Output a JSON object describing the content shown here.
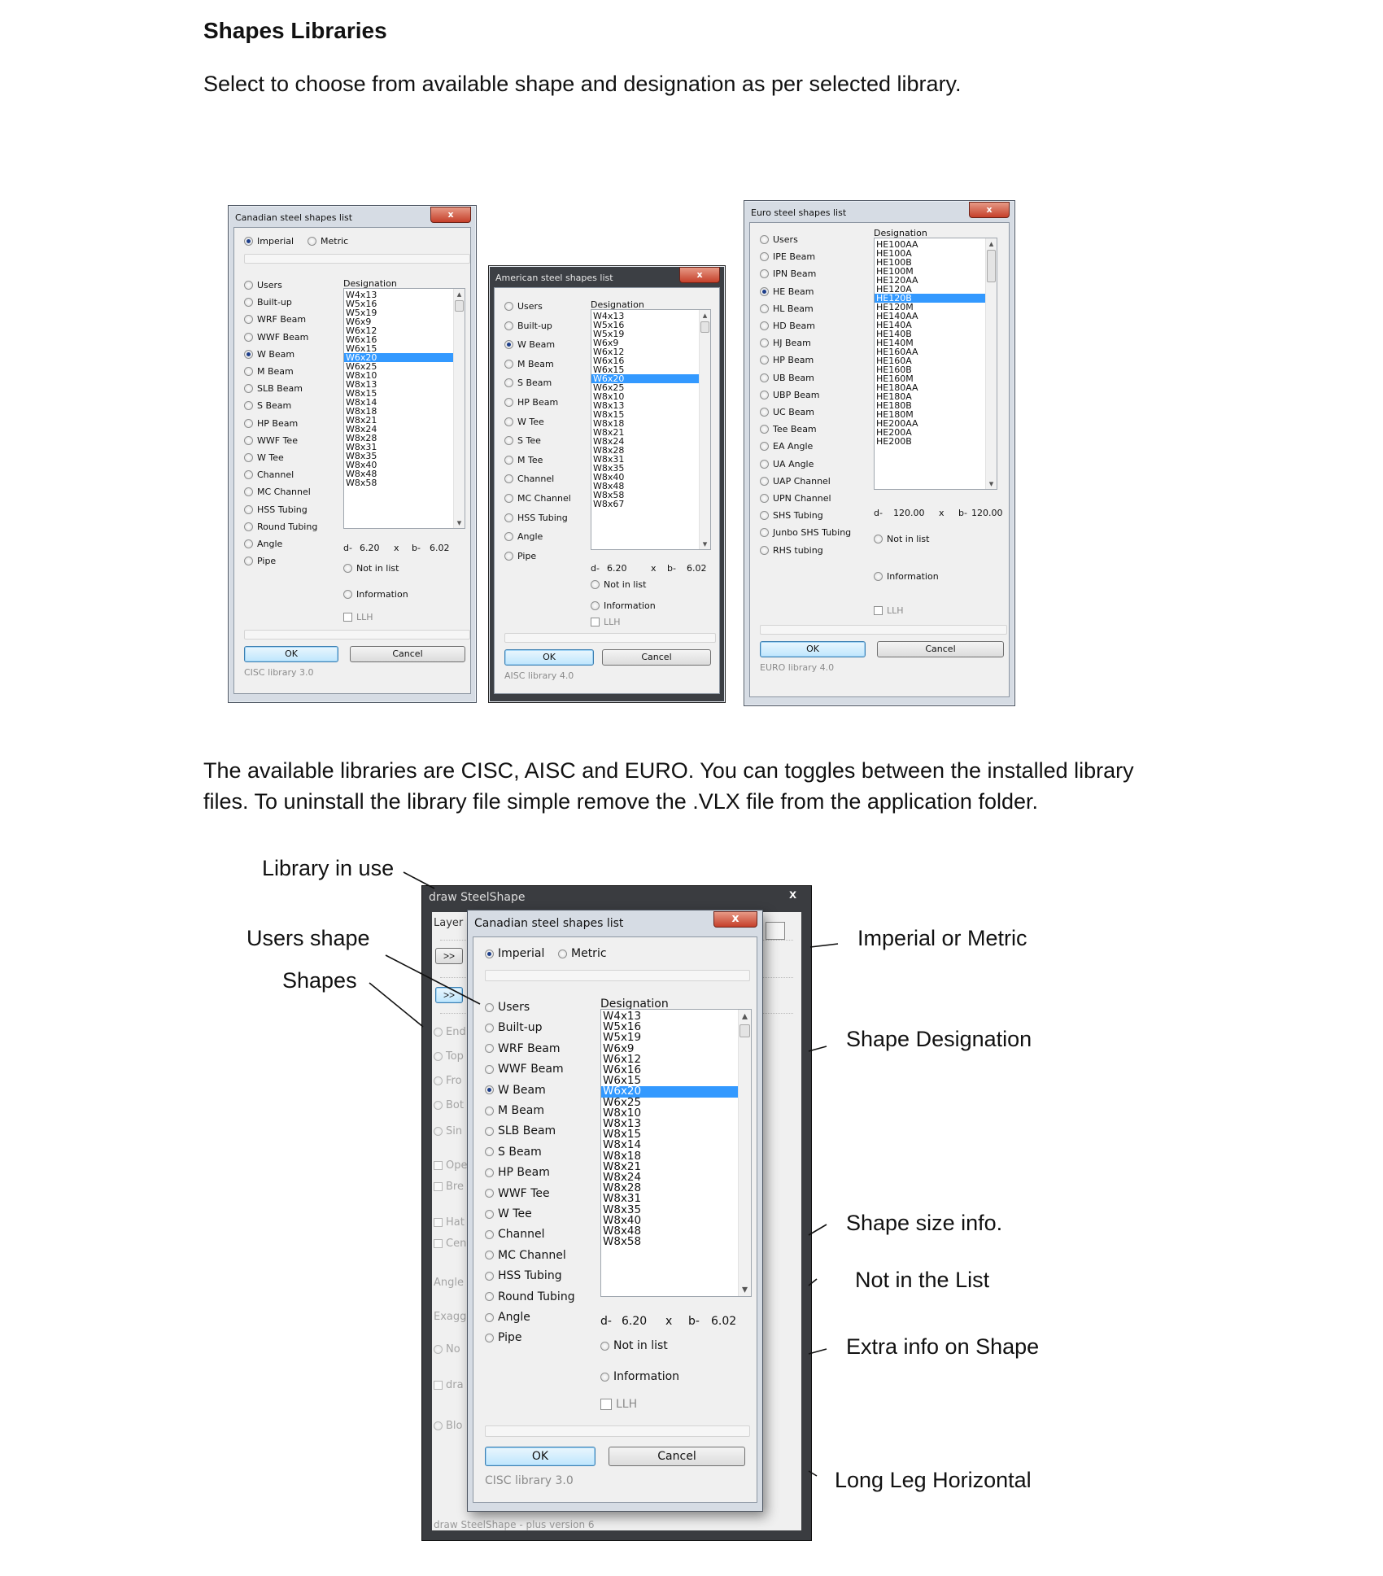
{
  "page": {
    "title": "Shapes Libraries",
    "intro": "Select to choose from available shape and designation as per selected library.",
    "para2_line1": "The available libraries are CISC, AISC and EURO.  You can toggles between the installed library",
    "para2_line2": "files.  To uninstall the library file simple remove the .VLX file from the application folder."
  },
  "canadian": {
    "title": "Canadian steel shapes list",
    "unit_options": [
      "Imperial",
      "Metric"
    ],
    "shapes": [
      "Users",
      "Built-up",
      "WRF Beam",
      "WWF Beam",
      "W Beam",
      "M Beam",
      "SLB Beam",
      "S Beam",
      "HP Beam",
      "WWF Tee",
      "W Tee",
      "Channel",
      "MC Channel",
      "HSS Tubing",
      "Round Tubing",
      "Angle",
      "Pipe"
    ],
    "selected_shape": "W Beam",
    "designation_header": "Designation",
    "designations": [
      "W4x13",
      "W5x16",
      "W5x19",
      "W6x9",
      "W6x12",
      "W6x16",
      "W6x15",
      "W6x20",
      "W6x25",
      "W8x10",
      "W8x13",
      "W8x15",
      "W8x14",
      "W8x18",
      "W8x21",
      "W8x24",
      "W8x28",
      "W8x31",
      "W8x35",
      "W8x40",
      "W8x48",
      "W8x58"
    ],
    "selected_designation": "W6x20",
    "d_label": "d-",
    "d_value": "6.20",
    "x_label": "x",
    "b_label": "b-",
    "b_value": "6.02",
    "not_in_list": "Not in list",
    "information": "Information",
    "llh": "LLH",
    "ok": "OK",
    "cancel": "Cancel",
    "library": "CISC library 3.0",
    "close": "x"
  },
  "american": {
    "title": "American steel shapes list",
    "shapes": [
      "Users",
      "Built-up",
      "W Beam",
      "M Beam",
      "S Beam",
      "HP Beam",
      "W Tee",
      "S Tee",
      "M Tee",
      "Channel",
      "MC Channel",
      "HSS Tubing",
      "Angle",
      "Pipe"
    ],
    "selected_shape": "W Beam",
    "designation_header": "Designation",
    "designations": [
      "W4x13",
      "W5x16",
      "W5x19",
      "W6x9",
      "W6x12",
      "W6x16",
      "W6x15",
      "W6x20",
      "W6x25",
      "W8x10",
      "W8x13",
      "W8x15",
      "W8x18",
      "W8x21",
      "W8x24",
      "W8x28",
      "W8x31",
      "W8x35",
      "W8x40",
      "W8x48",
      "W8x58",
      "W8x67"
    ],
    "selected_designation": "W6x20",
    "d_label": "d-",
    "d_value": "6.20",
    "x_label": "x",
    "b_label": "b-",
    "b_value": "6.02",
    "not_in_list": "Not in list",
    "information": "Information",
    "llh": "LLH",
    "ok": "OK",
    "cancel": "Cancel",
    "library": "AISC library 4.0",
    "close": "x"
  },
  "euro": {
    "title": "Euro steel shapes list",
    "shapes": [
      "Users",
      "IPE Beam",
      "IPN Beam",
      "HE Beam",
      "HL Beam",
      "HD Beam",
      "HJ Beam",
      "HP Beam",
      "UB Beam",
      "UBP Beam",
      "UC Beam",
      "Tee Beam",
      "EA Angle",
      "UA Angle",
      "UAP Channel",
      "UPN Channel",
      "SHS Tubing",
      "Junbo SHS Tubing",
      "RHS tubing"
    ],
    "selected_shape": "HE Beam",
    "designation_header": "Designation",
    "designations": [
      "HE100AA",
      "HE100A",
      "HE100B",
      "HE100M",
      "HE120AA",
      "HE120A",
      "HE120B",
      "HE120M",
      "HE140AA",
      "HE140A",
      "HE140B",
      "HE140M",
      "HE160AA",
      "HE160A",
      "HE160B",
      "HE160M",
      "HE180AA",
      "HE180A",
      "HE180B",
      "HE180M",
      "HE200AA",
      "HE200A",
      "HE200B"
    ],
    "selected_designation": "HE120B",
    "d_label": "d-",
    "d_value": "120.00",
    "x_label": "x",
    "b_label": "b-",
    "b_value": "120.00",
    "not_in_list": "Not in list",
    "information": "Information",
    "llh": "LLH",
    "ok": "OK",
    "cancel": "Cancel",
    "library": "EURO library 4.0",
    "close": "x"
  },
  "app": {
    "title": "draw SteelShape",
    "close": "x",
    "layer_label": "Layer",
    "chevron": ">>",
    "ghost_items": [
      "End",
      "Top",
      "Fro",
      "Bot",
      "Sin",
      "Ope",
      "Bre",
      "Hat",
      "Cen",
      "Angle",
      "Exagg",
      "No",
      "dra",
      "Blo"
    ],
    "footer": "draw SteelShape - plus version 6"
  },
  "annotations": {
    "library_in_use": "Library in use",
    "users_shape": "Users shape",
    "shapes": "Shapes",
    "imperial_or_metric": "Imperial or Metric",
    "shape_designation": "Shape Designation",
    "shape_size_info": "Shape size info.",
    "not_in_the_list": "Not in the List",
    "extra_info": "Extra info on Shape",
    "long_leg": "Long Leg Horizontal"
  }
}
